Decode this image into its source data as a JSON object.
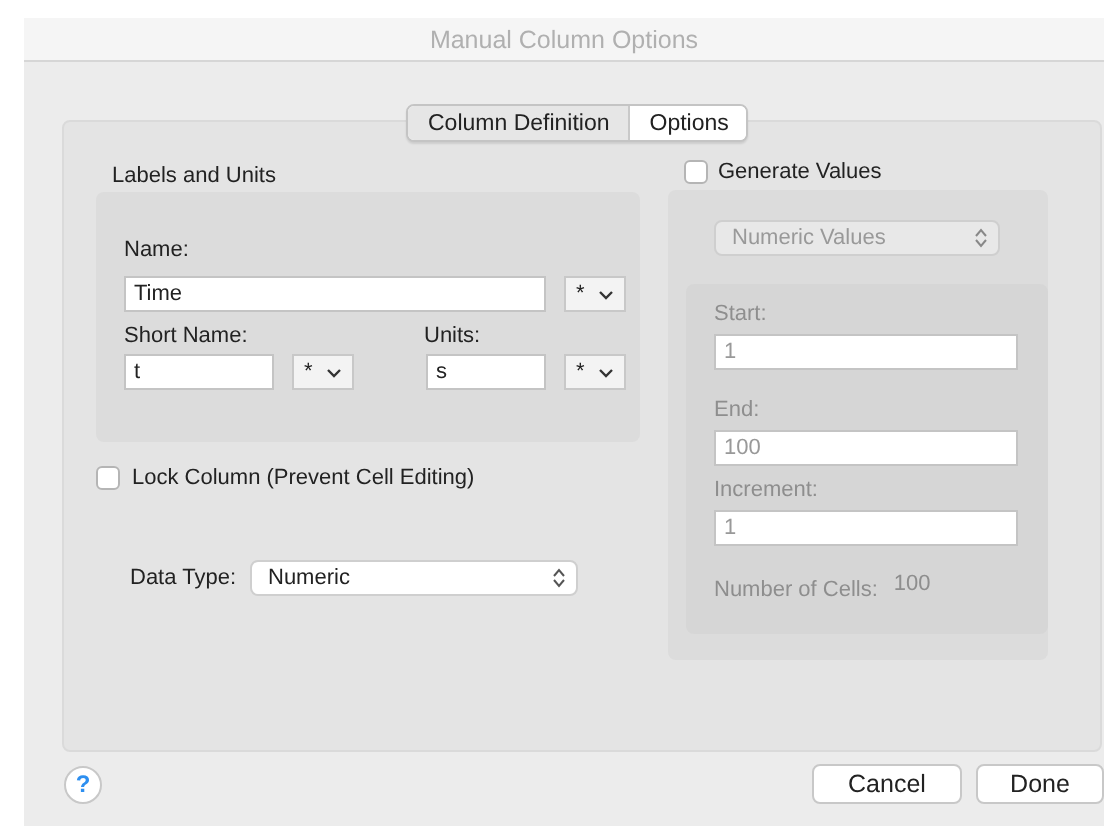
{
  "window": {
    "title": "Manual Column Options"
  },
  "tabs": [
    {
      "label": "Column Definition",
      "selected": true
    },
    {
      "label": "Options",
      "selected": false
    }
  ],
  "labels_and_units": {
    "title": "Labels and Units",
    "name_label": "Name:",
    "name": "Time",
    "name_menu": "*",
    "short_name_label": "Short Name:",
    "short_name": "t",
    "short_name_menu": "*",
    "units_label": "Units:",
    "units": "s",
    "units_menu": "*"
  },
  "lock_column": {
    "label": "Lock Column (Prevent Cell Editing)",
    "checked": false
  },
  "data_type": {
    "label": "Data Type:",
    "value": "Numeric"
  },
  "generate_values": {
    "label": "Generate Values",
    "checked": false,
    "mode": "Numeric Values",
    "start_label": "Start:",
    "start": "1",
    "end_label": "End:",
    "end": "100",
    "increment_label": "Increment:",
    "increment": "1",
    "count_label": "Number of Cells:",
    "count": "100"
  },
  "help": {
    "label": "?"
  },
  "buttons": [
    {
      "label": "Cancel"
    },
    {
      "label": "Done"
    }
  ]
}
